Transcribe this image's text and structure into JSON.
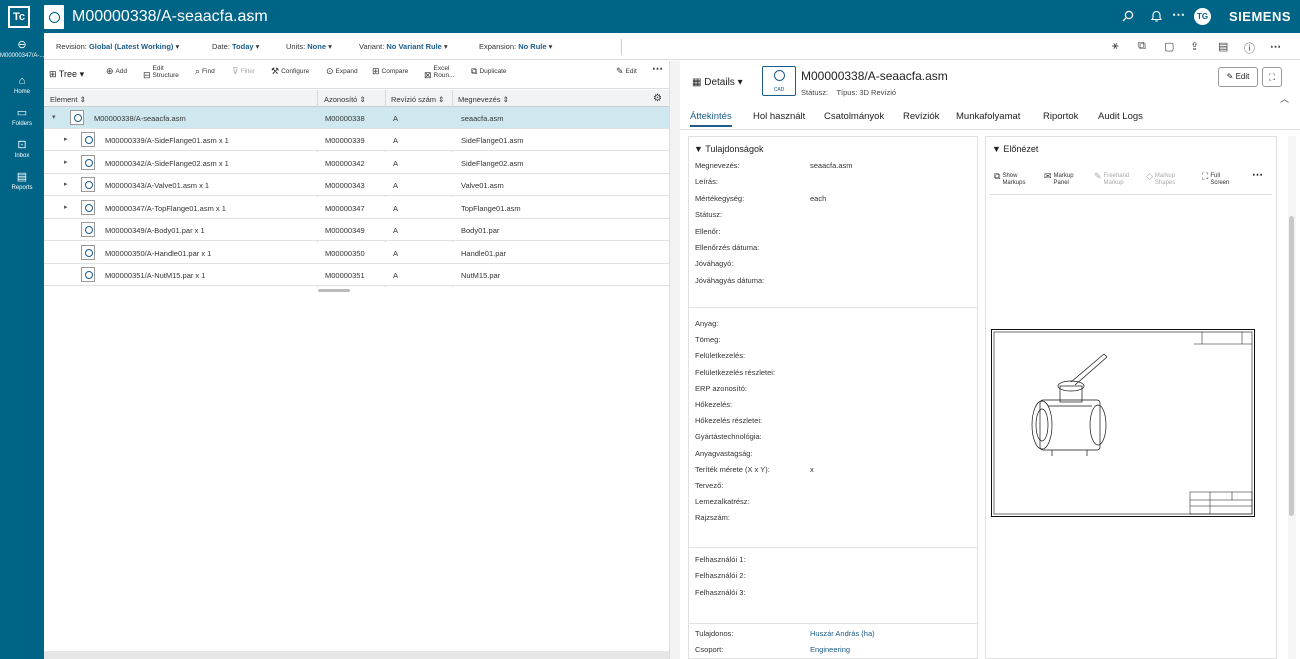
{
  "topbar": {
    "logo": "Tc",
    "title": "M00000338/A-seaacfa.asm",
    "chevron": "›",
    "avatar": "TG",
    "brand": "SIEMENS",
    "icons": [
      "search-icon",
      "bell-icon",
      "more-icon"
    ]
  },
  "leftnav": {
    "items": [
      {
        "label": "M00000347/A-...",
        "icon": "back-icon"
      },
      {
        "label": "Home",
        "icon": "home-icon"
      },
      {
        "label": "Folders",
        "icon": "folder-icon"
      },
      {
        "label": "Inbox",
        "icon": "inbox-icon"
      },
      {
        "label": "Reports",
        "icon": "reports-icon"
      }
    ]
  },
  "context": {
    "revision_label": "Revision:",
    "revision_value": "Global (Latest Working)",
    "date_label": "Date:",
    "date_value": "Today",
    "units_label": "Units:",
    "units_value": "None",
    "variant_label": "Variant:",
    "variant_value": "No Variant Rule",
    "expansion_label": "Expansion:",
    "expansion_value": "No Rule"
  },
  "toolbar": {
    "tree": "Tree",
    "add": "Add",
    "edit_structure": "Edit Structure",
    "find": "Find",
    "filter": "Filter",
    "configure": "Configure",
    "expand": "Expand",
    "compare": "Compare",
    "excel": "Excel Roun...",
    "duplicate": "Duplicate",
    "edit": "Edit"
  },
  "table": {
    "headers": {
      "element": "Element",
      "id": "Azonosító",
      "rev": "Revízió szám",
      "name": "Megnevezés"
    },
    "rows": [
      {
        "element": "M00000338/A-seaacfa.asm",
        "id": "M00000338",
        "rev": "A",
        "name": "seaacfa.asm",
        "expander": "▾"
      },
      {
        "element": "M00000339/A-SideFlange01.asm x 1",
        "id": "M00000339",
        "rev": "A",
        "name": "SideFlange01.asm",
        "expander": "▸"
      },
      {
        "element": "M00000342/A-SideFlange02.asm x 1",
        "id": "M00000342",
        "rev": "A",
        "name": "SideFlange02.asm",
        "expander": "▸"
      },
      {
        "element": "M00000343/A-Valve01.asm x 1",
        "id": "M00000343",
        "rev": "A",
        "name": "Valve01.asm",
        "expander": "▸"
      },
      {
        "element": "M00000347/A-TopFlange01.asm x 1",
        "id": "M00000347",
        "rev": "A",
        "name": "TopFlange01.asm",
        "expander": "▸"
      },
      {
        "element": "M00000349/A-Body01.par x 1",
        "id": "M00000349",
        "rev": "A",
        "name": "Body01.par",
        "expander": ""
      },
      {
        "element": "M00000350/A-Handle01.par x 1",
        "id": "M00000350",
        "rev": "A",
        "name": "Handle01.par",
        "expander": ""
      },
      {
        "element": "M00000351/A-NutM15.par x 1",
        "id": "M00000351",
        "rev": "A",
        "name": "NutM15.par",
        "expander": ""
      }
    ]
  },
  "details": {
    "button": "Details",
    "cad_label": "CAD",
    "title": "M00000338/A-seaacfa.asm",
    "status_label": "Státusz:",
    "type_label": "Típus:",
    "type_value": "3D Revízió",
    "edit": "Edit"
  },
  "tabs": [
    "Áttekintés",
    "Hol használt",
    "Csatolmányok",
    "Revíziók",
    "Munkafolyamat",
    "Riportok",
    "Audit Logs"
  ],
  "properties": {
    "title": "▼ Tulajdonságok",
    "group1": [
      {
        "label": "Megnevezés:",
        "value": "seaacfa.asm"
      },
      {
        "label": "Leírás:",
        "value": ""
      },
      {
        "label": "Mértékegység:",
        "value": "each"
      },
      {
        "label": "Státusz:",
        "value": ""
      },
      {
        "label": "Ellenőr:",
        "value": ""
      },
      {
        "label": "Ellenőrzés dátuma:",
        "value": ""
      },
      {
        "label": "Jóváhagyó:",
        "value": ""
      },
      {
        "label": "Jóváhagyás dátuma:",
        "value": ""
      }
    ],
    "group2": [
      {
        "label": "Anyag:",
        "value": ""
      },
      {
        "label": "Tömeg:",
        "value": ""
      },
      {
        "label": "Felületkezelés:",
        "value": ""
      },
      {
        "label": "Felületkezelés részletei:",
        "value": ""
      },
      {
        "label": "ERP azonosító:",
        "value": ""
      },
      {
        "label": "Hőkezelés:",
        "value": ""
      },
      {
        "label": "Hőkezelés részletei:",
        "value": ""
      },
      {
        "label": "Gyártástechnológia:",
        "value": ""
      },
      {
        "label": "Anyagvastagság:",
        "value": ""
      },
      {
        "label": "Teríték mérete (X x Y):",
        "value": "x"
      },
      {
        "label": "Tervező:",
        "value": ""
      },
      {
        "label": "Lemezalkatrész:",
        "value": ""
      },
      {
        "label": "Rajzszám:",
        "value": ""
      }
    ],
    "group3": [
      {
        "label": "Felhasználói 1:",
        "value": ""
      },
      {
        "label": "Felhasználói 2:",
        "value": ""
      },
      {
        "label": "Felhasználói 3:",
        "value": ""
      }
    ],
    "group4": [
      {
        "label": "Tulajdonos:",
        "value": "Huszár András (ha)"
      },
      {
        "label": "Csoport:",
        "value": "Engineering"
      }
    ]
  },
  "preview": {
    "title": "▼ Előnézet",
    "tools": [
      {
        "label": "Show Markups",
        "enabled": true
      },
      {
        "label": "Markup Panel",
        "enabled": true
      },
      {
        "label": "Freehand Markup",
        "enabled": false
      },
      {
        "label": "Markup Shapes",
        "enabled": false
      },
      {
        "label": "Full Screen",
        "enabled": true
      }
    ]
  }
}
